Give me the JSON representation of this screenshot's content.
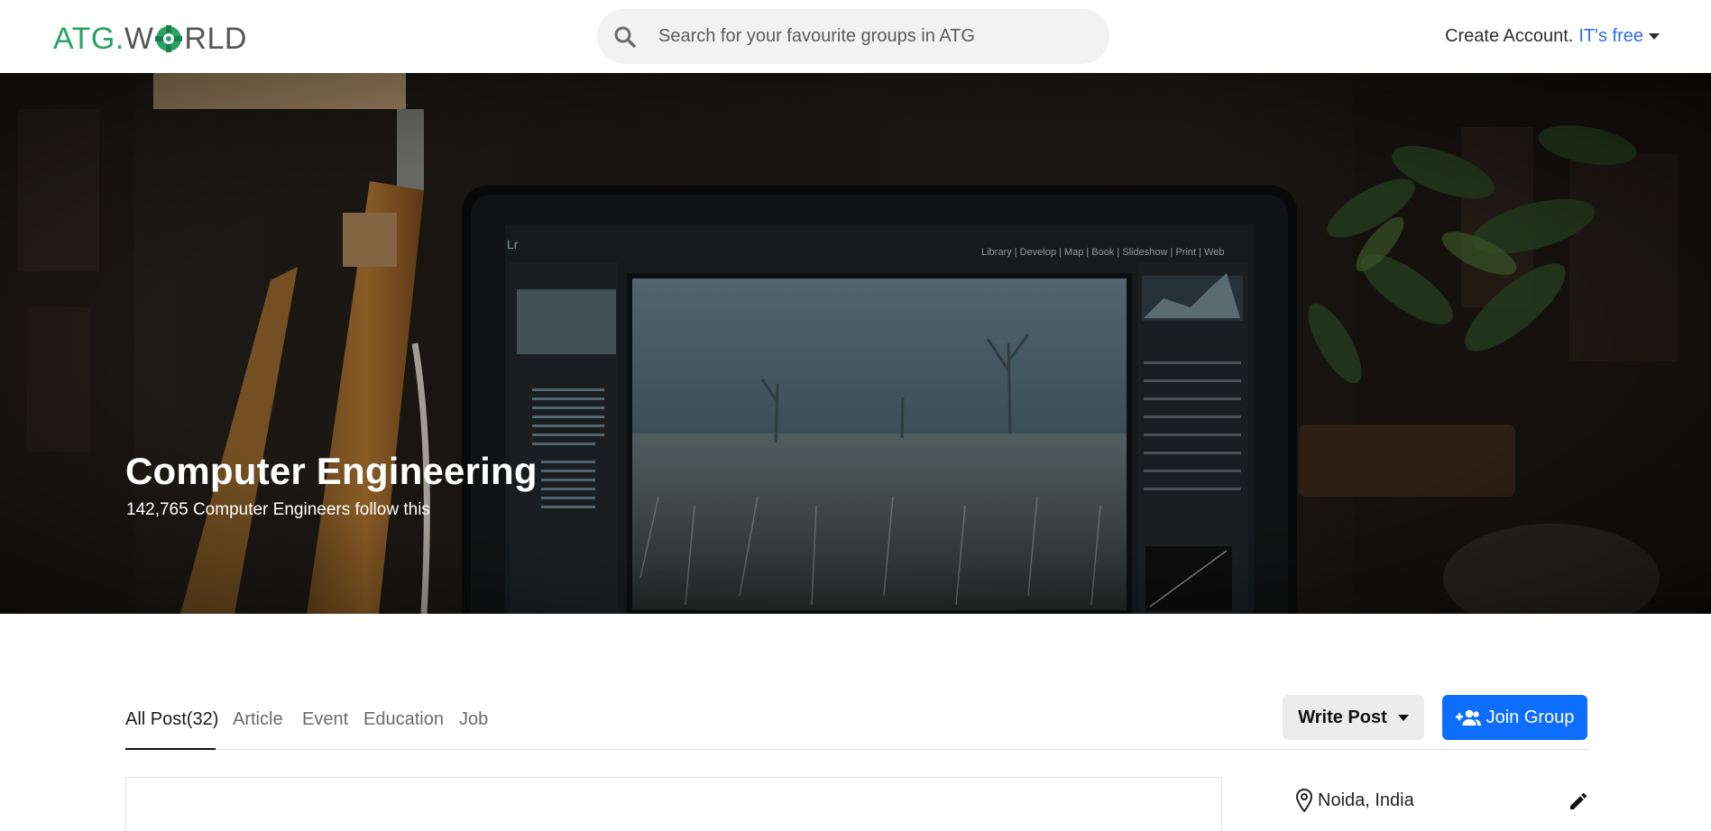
{
  "header": {
    "logo": {
      "left": "ATG.W",
      "right": "RLD",
      "icon": "atg-gear-logo-icon"
    },
    "search": {
      "placeholder": "Search for your favourite groups in ATG",
      "icon": "search-icon"
    },
    "account": {
      "label": "Create Account.",
      "highlight": "IT's free",
      "icon": "caret-down-icon"
    }
  },
  "hero": {
    "title": "Computer Engineering",
    "followers": "142,765 Computer Engineers follow this"
  },
  "tabs": {
    "items": [
      "All Post(32)",
      "Article",
      "Event",
      "Education",
      "Job"
    ],
    "active": "All Post(32)"
  },
  "actions": {
    "write_post": "Write Post",
    "join_group": "Join Group"
  },
  "sidebar": {
    "location": "Noida, India",
    "location_icon": "location-pin-icon",
    "edit_icon": "pencil-icon"
  },
  "colors": {
    "brand_green": "#27a365",
    "link_blue": "#2f6ee5",
    "primary_button": "#0d6efd"
  }
}
